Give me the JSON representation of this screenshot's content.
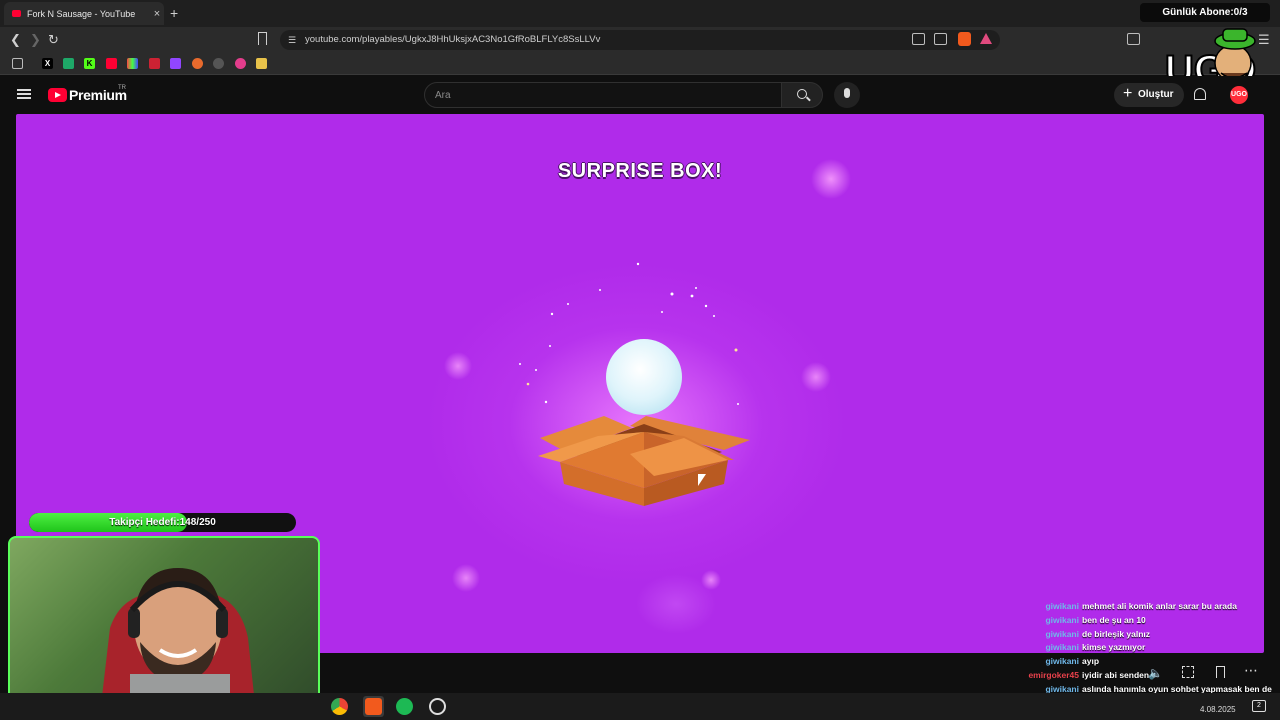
{
  "browser": {
    "tab_title": "Fork N Sausage - YouTube",
    "new_tab": "+",
    "close": "×",
    "url": "youtube.com/playables/UgkxJ8HhUksjxAC3No1GfRoBLFLYc8SsLLVv"
  },
  "overlay": {
    "subscriber_goal": "Günlük Abone:0/3",
    "follower_goal_label": "Takipçi Hedefi:148/250",
    "follower_goal_fraction": 0.592,
    "logo_text": "UGO"
  },
  "youtube": {
    "brand": "Premium",
    "region": "TR",
    "search_placeholder": "Ara",
    "create_label": "Oluştur",
    "avatar_text": "UGO"
  },
  "game": {
    "title": "SURPRISE BOX!"
  },
  "chat": [
    {
      "user": "giwikani",
      "text": "mehmet ali komik anlar sarar bu arada",
      "color": "#6fb7e8"
    },
    {
      "user": "giwikani",
      "text": "ben de şu an 10",
      "color": "#6fb7e8"
    },
    {
      "user": "giwikani",
      "text": "de birleşik yalnız",
      "color": "#6fb7e8"
    },
    {
      "user": "giwikani",
      "text": "kimse yazmıyor",
      "color": "#6fb7e8"
    },
    {
      "user": "giwikani",
      "text": "ayıp",
      "color": "#6fb7e8"
    },
    {
      "user": "emirgoker45",
      "text": "iyidir abi senden",
      "color": "#e8414b"
    },
    {
      "user": "giwikani",
      "text": "aslında hanımla oyun sohbet yapmasak ben de hep açarım yayını yanda da helal et kral",
      "color": "#6fb7e8"
    }
  ],
  "taskbar": {
    "date": "4.08.2025",
    "notification_count": "2"
  },
  "colors": {
    "game_bg": "#b02bea",
    "youtube_red": "#ff0033",
    "goal_green": "#1fc41a",
    "webcam_border": "#5aff5a"
  }
}
